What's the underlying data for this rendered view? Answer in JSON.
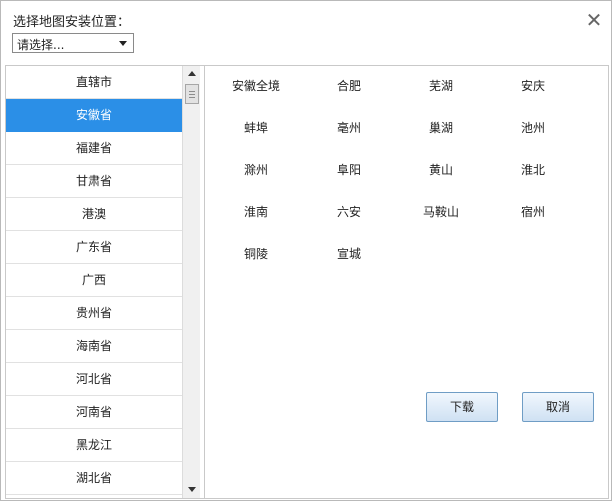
{
  "dialog": {
    "title": "选择地图安装位置：",
    "close_glyph": "✕"
  },
  "select": {
    "value": "请选择..."
  },
  "provinces": [
    {
      "label": "直辖市",
      "selected": false
    },
    {
      "label": "安徽省",
      "selected": true
    },
    {
      "label": "福建省",
      "selected": false
    },
    {
      "label": "甘肃省",
      "selected": false
    },
    {
      "label": "港澳",
      "selected": false
    },
    {
      "label": "广东省",
      "selected": false
    },
    {
      "label": "广西",
      "selected": false
    },
    {
      "label": "贵州省",
      "selected": false
    },
    {
      "label": "海南省",
      "selected": false
    },
    {
      "label": "河北省",
      "selected": false
    },
    {
      "label": "河南省",
      "selected": false
    },
    {
      "label": "黑龙江",
      "selected": false
    },
    {
      "label": "湖北省",
      "selected": false
    }
  ],
  "cities": [
    "安徽全境",
    "合肥",
    "芜湖",
    "安庆",
    "蚌埠",
    "亳州",
    "巢湖",
    "池州",
    "滁州",
    "阜阳",
    "黄山",
    "淮北",
    "淮南",
    "六安",
    "马鞍山",
    "宿州",
    "铜陵",
    "宣城"
  ],
  "buttons": {
    "download": "下载",
    "cancel": "取消"
  },
  "colors": {
    "selected_bg": "#2b8fe7",
    "button_border": "#6f9dc5"
  },
  "icons": {
    "close": "close-icon",
    "dropdown": "chevron-down-icon",
    "scroll_up": "arrow-up-icon",
    "scroll_down": "arrow-down-icon"
  }
}
